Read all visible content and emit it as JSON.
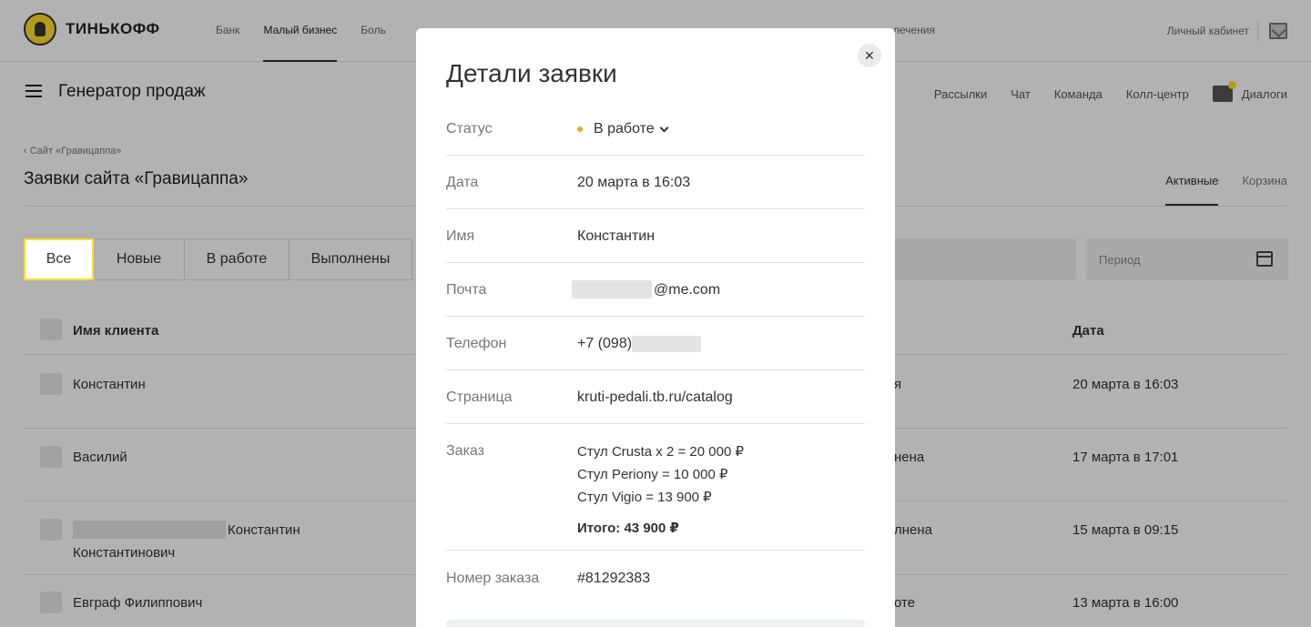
{
  "brand": {
    "name": "ТИНЬКОФФ"
  },
  "topnav": {
    "items": [
      "Банк",
      "Малый бизнес",
      "Боль"
    ],
    "trailing_text": "лечения",
    "cabinet": "Личный кабинет"
  },
  "subheader": {
    "title": "Генератор продаж",
    "nav": [
      "Рассылки",
      "Чат",
      "Команда",
      "Колл-центр"
    ],
    "dialogs": "Диалоги"
  },
  "page": {
    "back_link": "Сайт «Гравицаппа»",
    "title": "Заявки сайта «Гравицаппа»",
    "tabs": [
      "Активные",
      "Корзина"
    ],
    "filters": [
      "Все",
      "Новые",
      "В работе",
      "Выполнены"
    ],
    "period_placeholder": "Период"
  },
  "table": {
    "headers": {
      "name": "Имя клиента",
      "date": "Дата"
    },
    "rows": [
      {
        "name": "Константин",
        "status_partial": "я",
        "date": "20 марта в 16:03"
      },
      {
        "name": "Василий",
        "status_partial": "нена",
        "date": "17 марта в 17:01"
      },
      {
        "name": "Константин",
        "name_line2": "Константинович",
        "status_partial": "лнена",
        "date": "15 марта в 09:15"
      },
      {
        "name": "Евграф Филиппович",
        "status_partial": "оте",
        "date": "13 марта в 16:00"
      }
    ]
  },
  "modal": {
    "title": "Детали заявки",
    "close_icon": "close-icon",
    "status": {
      "label": "Статус",
      "value": "В работе",
      "dot_color": "#f5a623"
    },
    "date": {
      "label": "Дата",
      "value": "20 марта в 16:03"
    },
    "name": {
      "label": "Имя",
      "value": "Константин"
    },
    "email": {
      "label": "Почта",
      "value": "@me.com"
    },
    "phone": {
      "label": "Телефон",
      "value": "+7 (098)"
    },
    "page": {
      "label": "Страница",
      "value": "kruti-pedali.tb.ru/catalog"
    },
    "order": {
      "label": "Заказ",
      "items": [
        "Стул Crusta x 2 = 20 000 ₽",
        "Стул Periony = 10 000 ₽",
        "Стул Vigio = 13 900 ₽"
      ],
      "total": "Итого: 43 900 ₽"
    },
    "order_number": {
      "label": "Номер заказа",
      "value": "#81292383"
    }
  },
  "colors": {
    "accent": "#ffdd2d",
    "status_dot": "#f5a623",
    "overlay": "rgba(0,0,0,0.30)"
  }
}
